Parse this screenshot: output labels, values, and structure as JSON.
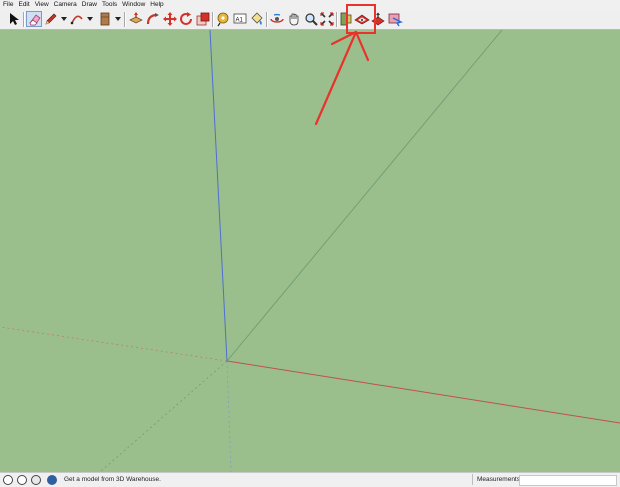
{
  "menu": {
    "items": [
      "File",
      "Edit",
      "View",
      "Camera",
      "Draw",
      "Tools",
      "Window",
      "Help"
    ]
  },
  "toolbar": {
    "tools": [
      {
        "id": "select",
        "icon": "select-arrow-icon"
      },
      {
        "id": "eraser",
        "icon": "eraser-icon"
      },
      {
        "id": "pencil",
        "icon": "pencil-icon"
      },
      {
        "id": "arc",
        "icon": "arc-icon"
      },
      {
        "id": "push-pull-box",
        "icon": "box-icon"
      },
      {
        "id": "push-pull",
        "icon": "push-pull-icon"
      },
      {
        "id": "follow-me",
        "icon": "follow-me-icon"
      },
      {
        "id": "move",
        "icon": "move-icon"
      },
      {
        "id": "rotate",
        "icon": "rotate-icon"
      },
      {
        "id": "scale",
        "icon": "scale-icon"
      },
      {
        "id": "tape",
        "icon": "tape-measure-icon"
      },
      {
        "id": "text",
        "icon": "text-icon",
        "label": "A1"
      },
      {
        "id": "paint",
        "icon": "paint-bucket-icon"
      },
      {
        "id": "orbit",
        "icon": "orbit-icon"
      },
      {
        "id": "pan",
        "icon": "pan-icon"
      },
      {
        "id": "zoom",
        "icon": "zoom-icon"
      },
      {
        "id": "zoom-extents",
        "icon": "zoom-extents-icon"
      },
      {
        "id": "section",
        "icon": "section-plane-icon"
      },
      {
        "id": "3d-warehouse",
        "icon": "3d-warehouse-icon"
      },
      {
        "id": "share-model",
        "icon": "share-model-icon"
      },
      {
        "id": "extension-warehouse",
        "icon": "extension-warehouse-icon"
      }
    ]
  },
  "status": {
    "message": "Get a model from 3D Warehouse.",
    "measurements_label": "Measurements"
  },
  "colors": {
    "viewport": "#9bbf8c",
    "annotation": "#e8322c",
    "red_axis": "#c0504d",
    "green_axis": "#6f9c74",
    "blue_axis": "#4f6fd0"
  }
}
